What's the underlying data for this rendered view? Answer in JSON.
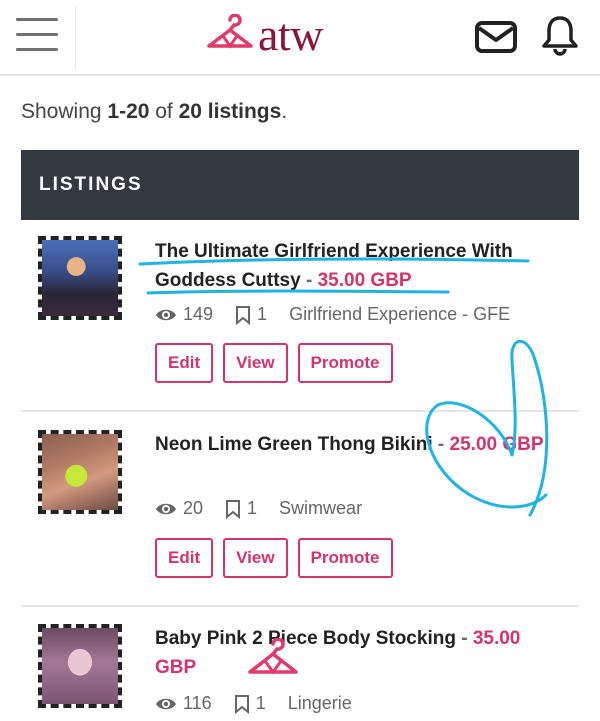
{
  "header": {
    "logo_text": "atw",
    "icons": [
      "menu-icon",
      "hanger-logo-icon",
      "mail-icon",
      "bell-icon"
    ]
  },
  "summary": {
    "prefix": "Showing ",
    "range": "1-20",
    "middle": " of ",
    "total": "20 listings",
    "suffix": "."
  },
  "section": {
    "title": "LISTINGS"
  },
  "colors": {
    "accent": "#d6336c",
    "brand": "#8a1538",
    "dark_bar": "#323941",
    "annotation": "#1fb3e6"
  },
  "listings": [
    {
      "title": "The Ultimate Girlfriend Experience With Goddess Cuttsy",
      "sep": " - ",
      "price": "35.00 GBP",
      "views": "149",
      "saves": "1",
      "category": "Girlfriend Experience - GFE",
      "buttons": {
        "edit": "Edit",
        "view": "View",
        "promote": "Promote"
      }
    },
    {
      "title": "Neon Lime Green Thong Bikini",
      "sep": " - ",
      "price": "25.00 GBP",
      "views": "20",
      "saves": "1",
      "category": "Swimwear",
      "buttons": {
        "edit": "Edit",
        "view": "View",
        "promote": "Promote"
      }
    },
    {
      "title": "Baby Pink 2 Piece Body Stocking",
      "sep": " - ",
      "price": "35.00 GBP",
      "views": "116",
      "saves": "1",
      "category": "Lingerie"
    }
  ]
}
